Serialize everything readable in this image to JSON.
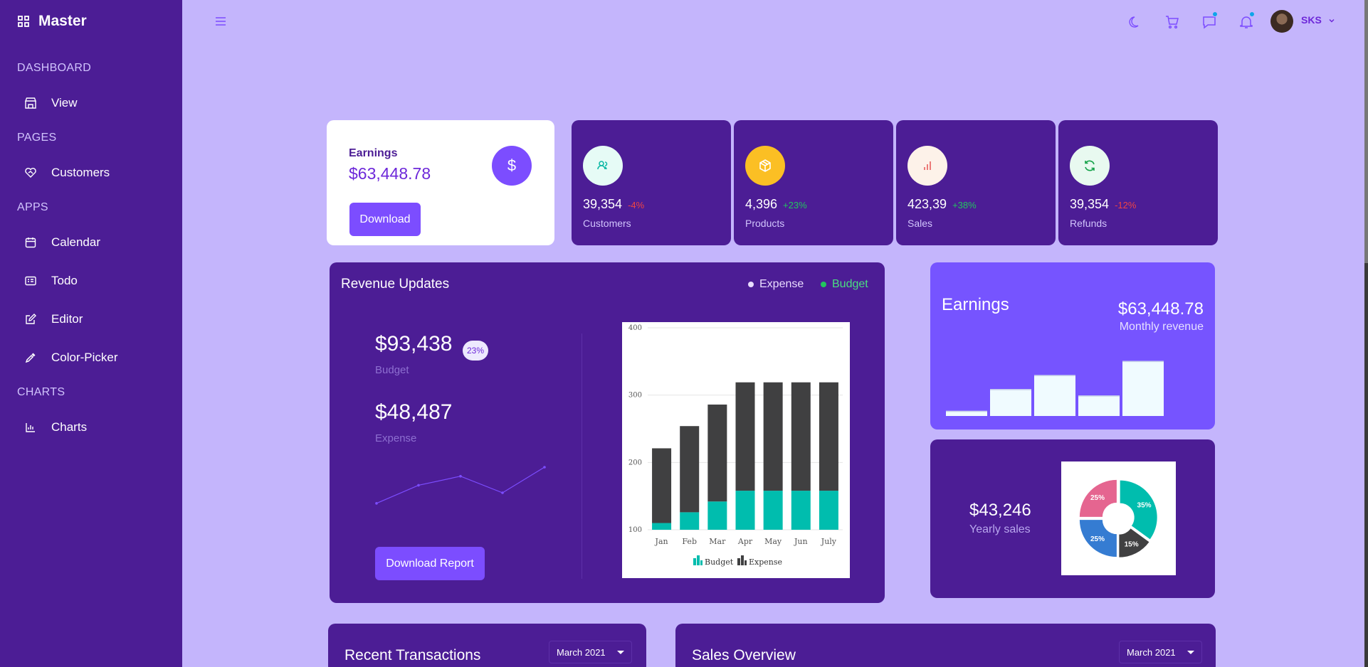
{
  "app": {
    "brand": "Master"
  },
  "sidebar": {
    "sections": [
      {
        "label": "DASHBOARD",
        "items": [
          {
            "label": "View",
            "icon": "store-icon"
          }
        ]
      },
      {
        "label": "PAGES",
        "items": [
          {
            "label": "Customers",
            "icon": "handshake-icon"
          }
        ]
      },
      {
        "label": "APPS",
        "items": [
          {
            "label": "Calendar",
            "icon": "calendar-icon"
          },
          {
            "label": "Todo",
            "icon": "kanban-icon"
          },
          {
            "label": "Editor",
            "icon": "edit-icon"
          },
          {
            "label": "Color-Picker",
            "icon": "dropper-icon"
          }
        ]
      },
      {
        "label": "CHARTS",
        "items": [
          {
            "label": "Charts",
            "icon": "bar-chart-icon"
          }
        ]
      }
    ]
  },
  "topbar": {
    "user": "SKS"
  },
  "earnings_card": {
    "label": "Earnings",
    "value": "$63,448.78",
    "button": "Download",
    "icon": "dollar-icon"
  },
  "stats": [
    {
      "value": "39,354",
      "change": "-4%",
      "change_color": "#ef4444",
      "label": "Customers",
      "icon": "users-icon",
      "icon_bg": "#e6fbf6",
      "icon_color": "#0fb9a6"
    },
    {
      "value": "4,396",
      "change": "+23%",
      "change_color": "#22c55e",
      "label": "Products",
      "icon": "box-icon",
      "icon_bg": "#fbbf24",
      "icon_color": "#ffffff"
    },
    {
      "value": "423,39",
      "change": "+38%",
      "change_color": "#22c55e",
      "label": "Sales",
      "icon": "bar-chart-icon",
      "icon_bg": "#fdf2e9",
      "icon_color": "#e85d5d"
    },
    {
      "value": "39,354",
      "change": "-12%",
      "change_color": "#ef4444",
      "label": "Refunds",
      "icon": "refresh-icon",
      "icon_bg": "#e8f9f0",
      "icon_color": "#16a34a"
    }
  ],
  "revenue": {
    "title": "Revenue Updates",
    "legend": [
      {
        "label": "Expense",
        "color": "#e9dcff"
      },
      {
        "label": "Budget",
        "color": "#22c55e"
      }
    ],
    "budget_value": "$93,438",
    "budget_badge": "23%",
    "budget_label": "Budget",
    "expense_value": "$48,487",
    "expense_label": "Expense",
    "button": "Download Report"
  },
  "earnings2": {
    "title": "Earnings",
    "value": "$63,448.78",
    "subtitle": "Monthly revenue"
  },
  "yearly": {
    "value": "$43,246",
    "label": "Yearly sales"
  },
  "recent": {
    "title": "Recent Transactions",
    "select": "March 2021"
  },
  "sales_overview": {
    "title": "Sales Overview",
    "select": "March 2021"
  },
  "chart_data": [
    {
      "type": "bar",
      "stacked": true,
      "categories": [
        "Jan",
        "Feb",
        "Mar",
        "Apr",
        "May",
        "Jun",
        "July"
      ],
      "series": [
        {
          "name": "Budget",
          "color": "#00bdae",
          "values": [
            110,
            126,
            142,
            158,
            158,
            158,
            158
          ]
        },
        {
          "name": "Expense",
          "color": "#404041",
          "values": [
            221,
            254,
            286,
            319,
            319,
            319,
            319
          ]
        }
      ],
      "ylim": [
        100,
        400
      ],
      "yticks": [
        100,
        200,
        300,
        400
      ],
      "grid": true,
      "legend": "bottom"
    },
    {
      "type": "line",
      "x": [
        1,
        2,
        3,
        4,
        5
      ],
      "values": [
        10,
        22,
        28,
        17,
        34
      ],
      "color": "#7c4dff"
    },
    {
      "type": "bar",
      "values": [
        8,
        42,
        64,
        32,
        86
      ],
      "color": "#f0fbff"
    },
    {
      "type": "pie",
      "donut": true,
      "slices": [
        {
          "label": "35%",
          "value": 35,
          "color": "#00bdae"
        },
        {
          "label": "15%",
          "value": 15,
          "color": "#404041"
        },
        {
          "label": "25%",
          "value": 25,
          "color": "#357cd2"
        },
        {
          "label": "25%",
          "value": 25,
          "color": "#e56590"
        }
      ]
    }
  ]
}
